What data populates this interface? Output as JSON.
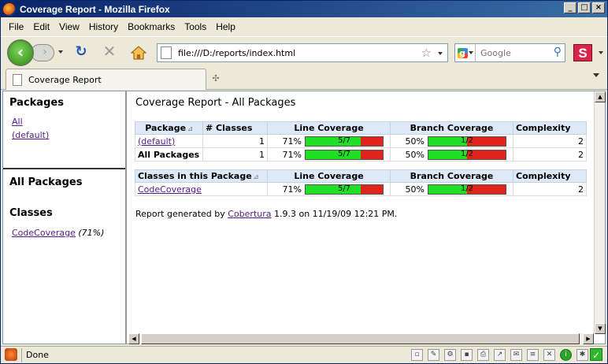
{
  "window": {
    "title": "Coverage Report - Mozilla Firefox"
  },
  "menu": [
    "File",
    "Edit",
    "View",
    "History",
    "Bookmarks",
    "Tools",
    "Help"
  ],
  "nav": {
    "url": "file:///D:/reports/index.html",
    "search_placeholder": "Google"
  },
  "tab": {
    "label": "Coverage Report"
  },
  "left_pane": {
    "packages_heading": "Packages",
    "packages": [
      "All",
      "(default)"
    ],
    "all_packages_heading": "All Packages",
    "classes_heading": "Classes",
    "class_name": "CodeCoverage",
    "class_pct": "(71%)"
  },
  "report": {
    "title": "Coverage Report - All Packages",
    "pkg_table": {
      "headers": [
        "Package",
        "# Classes",
        "Line Coverage",
        "Branch Coverage",
        "Complexity"
      ],
      "rows": [
        {
          "name": "(default)",
          "classes": "1",
          "line_pct": "71%",
          "line_frac": "5/7",
          "line_value": 0.714,
          "branch_pct": "50%",
          "branch_frac": "1/2",
          "branch_value": 0.5,
          "complexity": "2"
        },
        {
          "name": "All Packages",
          "classes": "1",
          "line_pct": "71%",
          "line_frac": "5/7",
          "line_value": 0.714,
          "branch_pct": "50%",
          "branch_frac": "1/2",
          "branch_value": 0.5,
          "complexity": "2"
        }
      ]
    },
    "class_table": {
      "headers": [
        "Classes in this Package",
        "Line Coverage",
        "Branch Coverage",
        "Complexity"
      ],
      "rows": [
        {
          "name": "CodeCoverage",
          "line_pct": "71%",
          "line_frac": "5/7",
          "line_value": 0.714,
          "branch_pct": "50%",
          "branch_frac": "1/2",
          "branch_value": 0.5,
          "complexity": "2"
        }
      ]
    },
    "footer_prefix": "Report generated by",
    "footer_link": "Cobertura",
    "footer_suffix": "1.9.3 on 11/19/09 12:21 PM."
  },
  "status": {
    "text": "Done"
  }
}
